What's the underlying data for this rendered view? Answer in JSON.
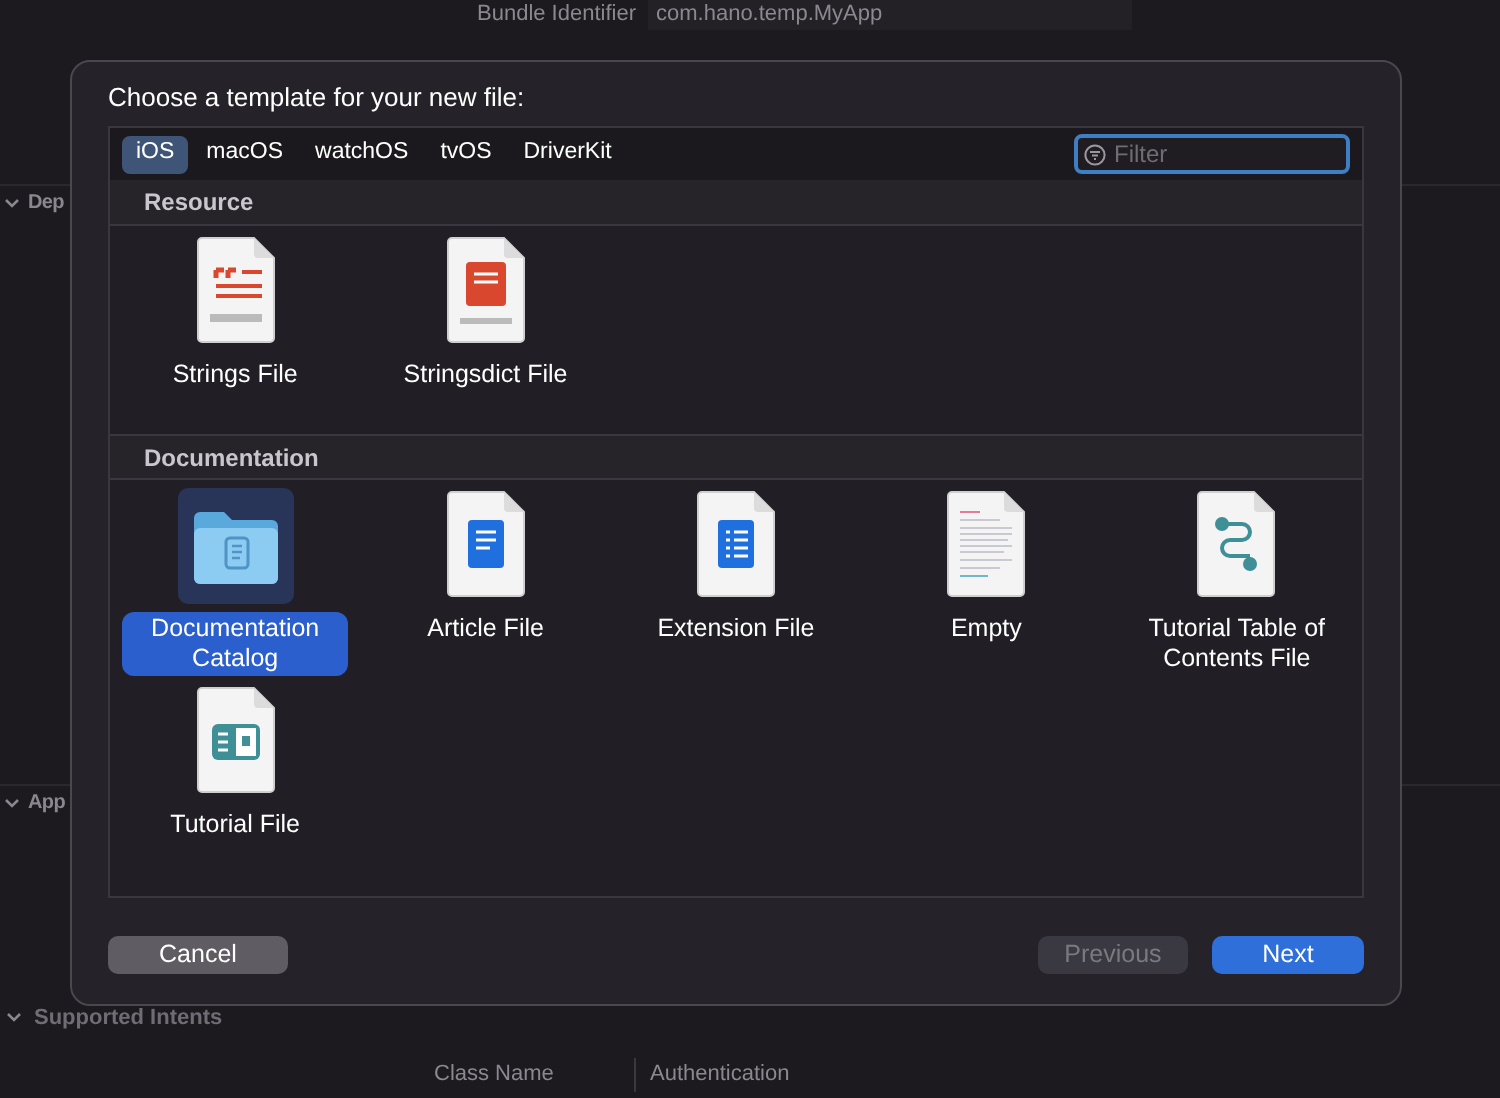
{
  "background": {
    "bundle_label": "Bundle Identifier",
    "bundle_value": "com.hano.temp.MyApp",
    "sections": [
      {
        "title": "Dep",
        "expanded": true
      },
      {
        "title": "App",
        "expanded": true
      }
    ],
    "supported_intents": {
      "title": "Supported Intents",
      "expanded": true,
      "columns": [
        "Class Name",
        "Authentication"
      ]
    }
  },
  "dialog": {
    "title": "Choose a template for your new file:",
    "tabs": [
      {
        "label": "iOS",
        "selected": true
      },
      {
        "label": "macOS",
        "selected": false
      },
      {
        "label": "watchOS",
        "selected": false
      },
      {
        "label": "tvOS",
        "selected": false
      },
      {
        "label": "DriverKit",
        "selected": false
      }
    ],
    "filter": {
      "placeholder": "Filter"
    },
    "sections": [
      {
        "title": "Resource",
        "items": [
          {
            "label": "Strings File",
            "kind": "strings",
            "selected": false
          },
          {
            "label": "Stringsdict File",
            "kind": "stringsdict",
            "selected": false
          }
        ]
      },
      {
        "title": "Documentation",
        "items": [
          {
            "label": "Documentation Catalog",
            "kind": "catalog",
            "selected": true
          },
          {
            "label": "Article File",
            "kind": "article",
            "selected": false
          },
          {
            "label": "Extension File",
            "kind": "extension",
            "selected": false
          },
          {
            "label": "Empty",
            "kind": "empty",
            "selected": false
          },
          {
            "label": "Tutorial Table of Contents File",
            "kind": "toc",
            "selected": false
          },
          {
            "label": "Tutorial File",
            "kind": "tutorial",
            "selected": false
          }
        ]
      }
    ],
    "buttons": [
      {
        "label": "Cancel",
        "kind": "cancel",
        "disabled": false
      },
      {
        "label": "Previous",
        "kind": "back",
        "disabled": true
      },
      {
        "label": "Next",
        "kind": "default",
        "disabled": false
      }
    ]
  }
}
